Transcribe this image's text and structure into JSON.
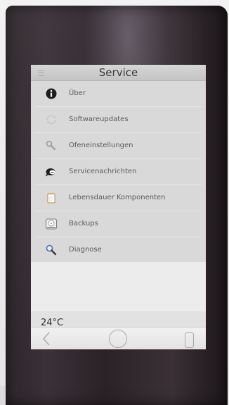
{
  "header": {
    "title": "Service"
  },
  "menu": {
    "items": [
      {
        "label": "Über",
        "icon": "info-icon"
      },
      {
        "label": "Softwareupdates",
        "icon": "update-icon"
      },
      {
        "label": "Ofeneinstellungen",
        "icon": "wrench-icon"
      },
      {
        "label": "Servicenachrichten",
        "icon": "message-icon"
      },
      {
        "label": "Lebensdauer Komponenten",
        "icon": "clipboard-icon"
      },
      {
        "label": "Backups",
        "icon": "backup-drive-icon"
      },
      {
        "label": "Diagnose",
        "icon": "magnifier-icon"
      }
    ]
  },
  "status": {
    "temperature": "24°C"
  },
  "navbar": {
    "icons": [
      "back-icon",
      "home-icon",
      "device-icon"
    ]
  },
  "colors": {
    "bezel": "#2d2529",
    "screen_bg": "#e2e2e2",
    "list_bg": "#d9d9d9",
    "titlebar": "#c9c9c9"
  }
}
